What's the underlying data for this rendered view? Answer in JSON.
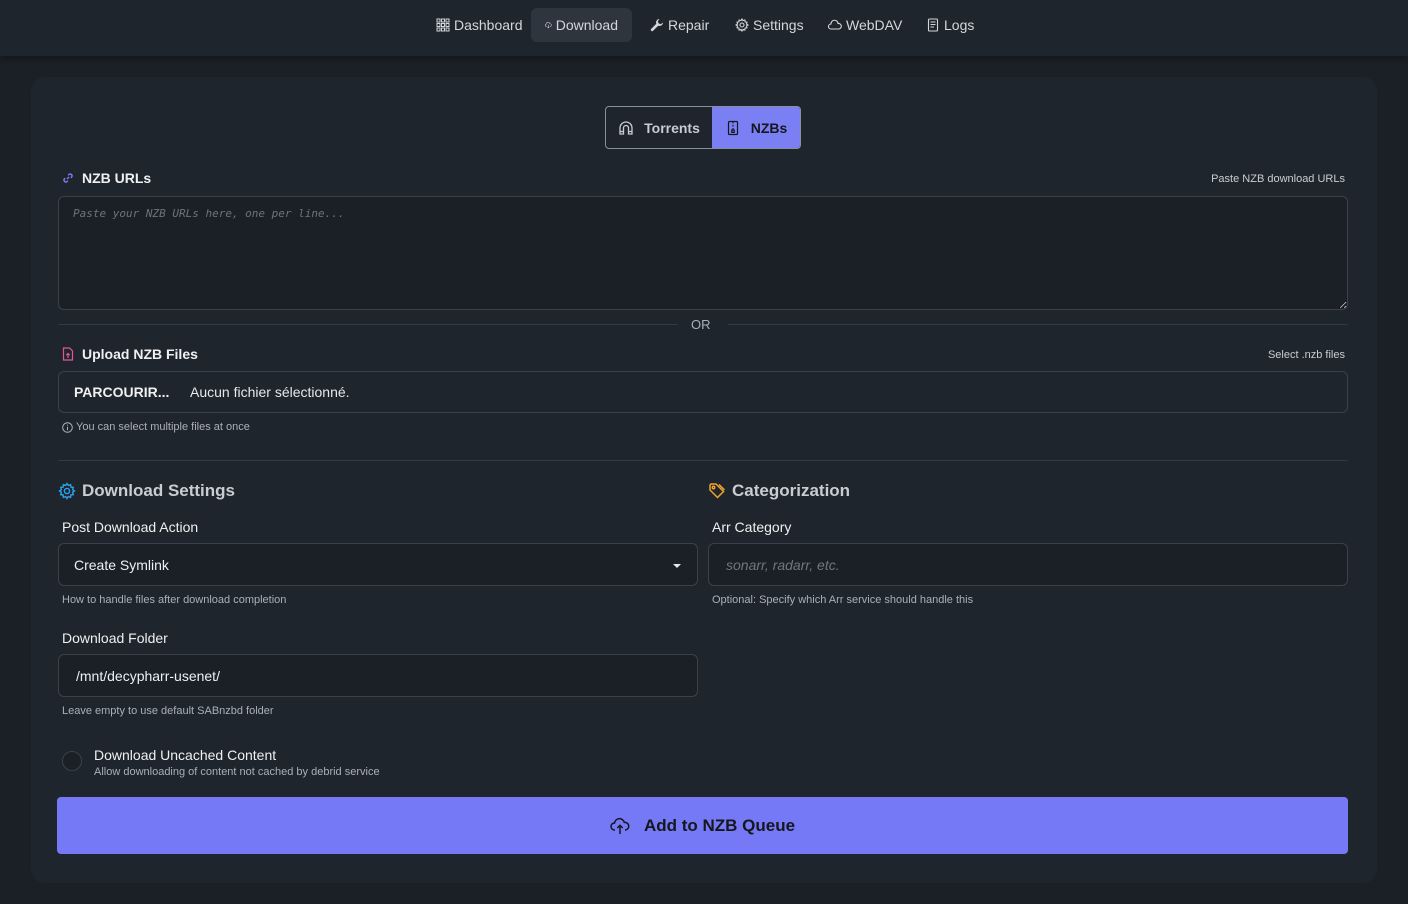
{
  "nav": {
    "items": [
      {
        "label": "Dashboard",
        "icon": "grid-icon"
      },
      {
        "label": "Download",
        "icon": "cloud-download-icon",
        "active": true
      },
      {
        "label": "Repair",
        "icon": "wrench-icon"
      },
      {
        "label": "Settings",
        "icon": "gear-icon"
      },
      {
        "label": "WebDAV",
        "icon": "cloud-icon"
      },
      {
        "label": "Logs",
        "icon": "document-icon"
      }
    ]
  },
  "mode_toggle": {
    "torrents_label": "Torrents",
    "nzbs_label": "NZBs",
    "selected": "NZBs"
  },
  "nzb_urls": {
    "label": "NZB URLs",
    "hint": "Paste NZB download URLs",
    "placeholder": "Paste your NZB URLs here, one per line...",
    "value": ""
  },
  "or_label": "OR",
  "upload": {
    "label": "Upload NZB Files",
    "hint": "Select .nzb files",
    "browse_label": "PARCOURIR...",
    "status": "Aucun fichier sélectionné.",
    "help": "You can select multiple files at once"
  },
  "download_settings": {
    "title": "Download Settings",
    "post_action": {
      "label": "Post Download Action",
      "value": "Create Symlink",
      "help": "How to handle files after download completion"
    },
    "folder": {
      "label": "Download Folder",
      "value": "/mnt/decypharr-usenet/",
      "help": "Leave empty to use default SABnzbd folder"
    },
    "uncached": {
      "label": "Download Uncached Content",
      "help": "Allow downloading of content not cached by debrid service",
      "checked": false
    }
  },
  "categorization": {
    "title": "Categorization",
    "arr_category": {
      "label": "Arr Category",
      "placeholder": "sonarr, radarr, etc.",
      "value": "",
      "help": "Optional: Specify which Arr service should handle this"
    }
  },
  "submit_label": "Add to NZB Queue",
  "colors": {
    "accent": "#7679f6",
    "background": "#1b2026",
    "card": "#1f252c",
    "settings_icon": "#2b9fe8",
    "tag_icon": "#f0a52a",
    "link_icon": "#7b7ff4",
    "file_icon": "#e0569b"
  }
}
